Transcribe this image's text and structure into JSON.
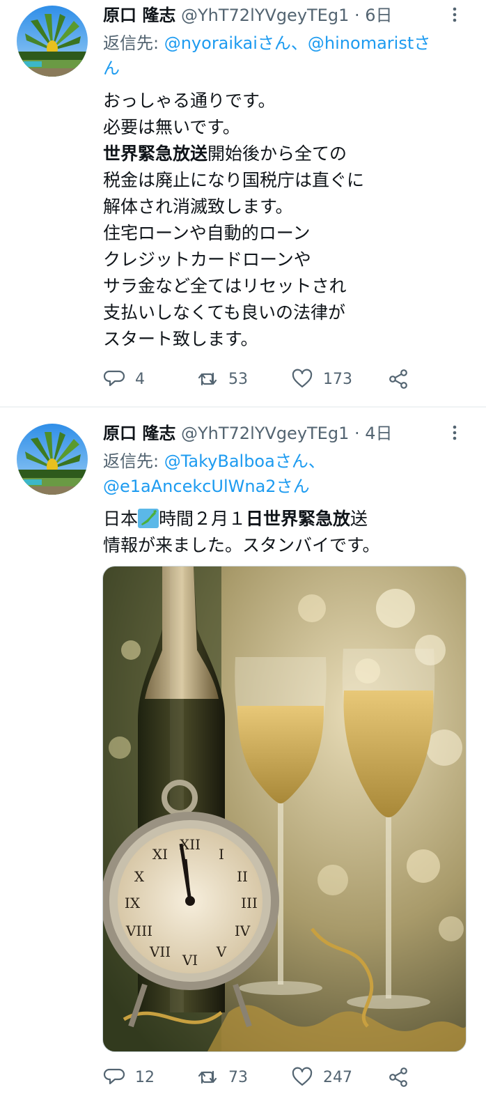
{
  "tweets": [
    {
      "name": "原口 隆志",
      "handle": "@YhT72lYVgeyTEg1",
      "dot": "·",
      "time": "6日",
      "reply_prefix": "返信先: ",
      "reply_mention_1": "@nyoraikaiさん、",
      "reply_mention_2": "@hinomaristさ",
      "reply_mention_3": "ん",
      "lines": [
        "おっしゃる通りです。",
        "必要は無いです。",
        "開始後から全ての",
        "税金は廃止になり国税庁は直ぐに",
        "解体され消滅致します。",
        "住宅ローンや自動的ローン",
        "クレジットカードローンや",
        "サラ金など全てはリセットされ",
        "支払いしなくても良いの法律が",
        "スタート致します。"
      ],
      "bold_phrase": "世界緊急放送",
      "replies": "4",
      "retweets": "53",
      "likes": "173"
    },
    {
      "name": "原口 隆志",
      "handle": "@YhT72lYVgeyTEg1",
      "dot": "·",
      "time": "4日",
      "reply_prefix": "返信先: ",
      "reply_mention_1": "@TakyBalboaさん、",
      "reply_mention_2": "@e1aAncekcUlWna2さん",
      "line1_a": "日本",
      "line1_b": "時間２月１",
      "line1_bold": "日世界緊急放",
      "line1_c": "送",
      "line2": "情報が来ました。スタンバイです。",
      "replies": "12",
      "retweets": "73",
      "likes": "247"
    }
  ],
  "icons": {
    "reply": "reply-icon",
    "retweet": "retweet-icon",
    "like": "heart-icon",
    "share": "share-icon",
    "more": "more-vertical-icon",
    "flag": "japan-map-emoji"
  },
  "colors": {
    "link": "#1d9bf0",
    "secondary": "#536471",
    "text": "#0f1419"
  }
}
